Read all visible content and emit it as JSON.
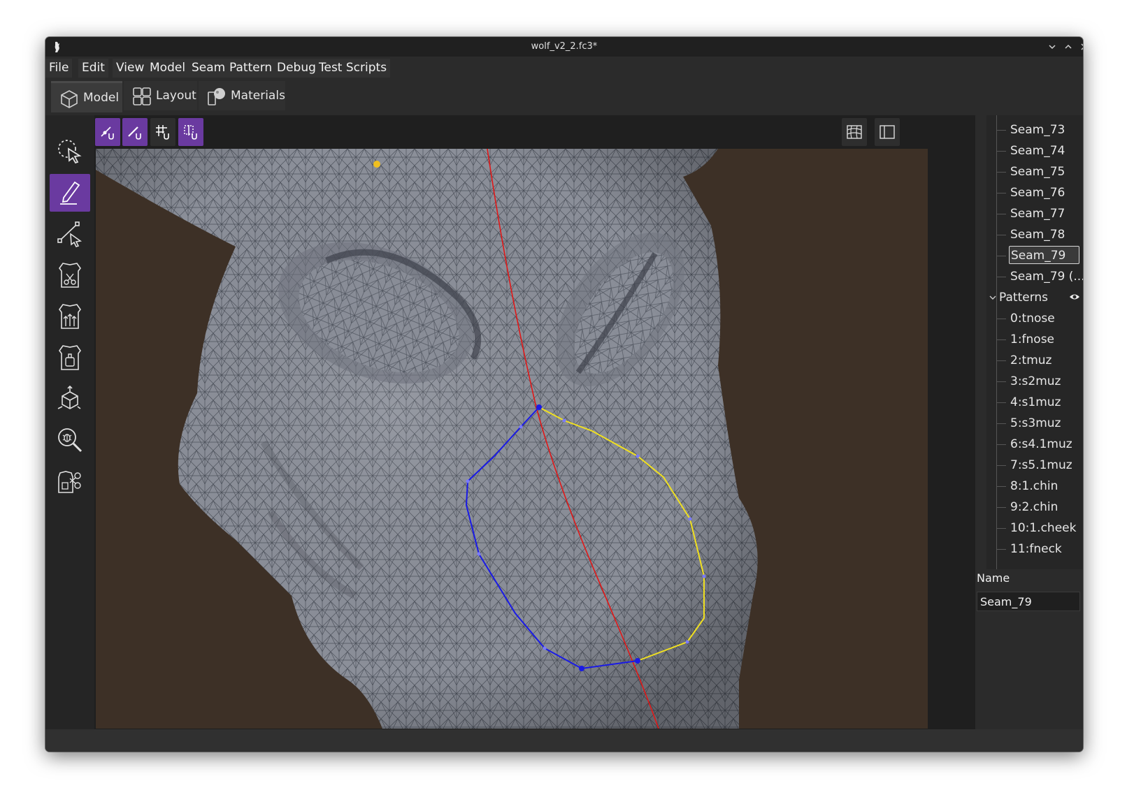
{
  "window": {
    "title": "wolf_v2_2.fc3*"
  },
  "menu": [
    "File",
    "Edit",
    "View",
    "Model",
    "Seam",
    "Pattern",
    "Debug",
    "Test Scripts"
  ],
  "tabs": [
    {
      "label": "Model",
      "icon": "cube-icon",
      "active": true
    },
    {
      "label": "Layout",
      "icon": "grid-layout-icon",
      "active": false
    },
    {
      "label": "Materials",
      "icon": "materials-icon",
      "active": false
    }
  ],
  "left_tools": [
    {
      "name": "select-tool",
      "icon": "lasso-cursor-icon",
      "active": false
    },
    {
      "name": "draw-seam-tool",
      "icon": "pencil-icon",
      "active": true
    },
    {
      "name": "edit-path-tool",
      "icon": "path-cursor-icon",
      "active": false
    },
    {
      "name": "cut-pattern-tool",
      "icon": "pattern-scissors-icon",
      "active": false
    },
    {
      "name": "pattern-arrows-tool",
      "icon": "pattern-arrows-icon",
      "active": false
    },
    {
      "name": "pattern-piece-tool",
      "icon": "pattern-piece-icon",
      "active": false
    },
    {
      "name": "transform-tool",
      "icon": "transform-cube-icon",
      "active": false
    },
    {
      "name": "inspect-tool",
      "icon": "magnify-bug-icon",
      "active": false
    },
    {
      "name": "cut-pieces-tool",
      "icon": "scissors-pieces-icon",
      "active": false
    }
  ],
  "viewport_tools": [
    {
      "name": "snap-vertex",
      "icon": "snap-vertex-icon",
      "active": true
    },
    {
      "name": "snap-edge",
      "icon": "snap-edge-icon",
      "active": true
    },
    {
      "name": "snap-grid",
      "icon": "snap-grid-icon",
      "active": false
    },
    {
      "name": "snap-bounds",
      "icon": "snap-bounds-icon",
      "active": true
    }
  ],
  "viewport_right_tools": [
    {
      "name": "view-mesh",
      "icon": "mesh-view-icon"
    },
    {
      "name": "toggle-panel",
      "icon": "panel-toggle-icon"
    }
  ],
  "tree": {
    "seams": [
      "Seam_73",
      "Seam_74",
      "Seam_75",
      "Seam_76",
      "Seam_77",
      "Seam_78",
      "Seam_79",
      "Seam_79 (..."
    ],
    "selected": "Seam_79",
    "patterns_group": "Patterns",
    "patterns": [
      "0:tnose",
      "1:fnose",
      "2:tmuz",
      "3:s2muz",
      "4:s1muz",
      "5:s3muz",
      "6:s4.1muz",
      "7:s5.1muz",
      "8:1.chin",
      "9:2.chin",
      "10:1.cheek",
      "11:fneck"
    ]
  },
  "properties": {
    "name_label": "Name",
    "name_value": "Seam_79"
  },
  "colors": {
    "accent": "#6a3aa0",
    "viewport_bg": "#3d3026",
    "mesh": "#8a8e98",
    "seam_red": "#e01818",
    "seam_blue": "#1a1ae6",
    "seam_yellow": "#f0e020"
  }
}
